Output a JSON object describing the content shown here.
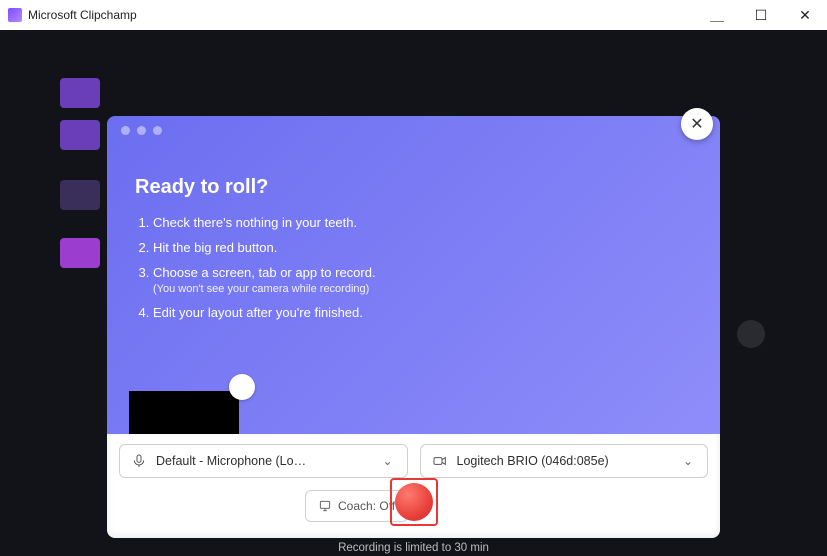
{
  "window": {
    "title": "Microsoft Clipchamp"
  },
  "modal": {
    "close_aria": "Close",
    "heading": "Ready to roll?",
    "steps": {
      "s1": "Check there's nothing in your teeth.",
      "s2": "Hit the big red button.",
      "s3": "Choose a screen, tab or app to record.",
      "s3_sub": "(You won't see your camera while recording)",
      "s4": "Edit your layout after you're finished."
    }
  },
  "controls": {
    "mic": {
      "label": "Default - Microphone (Lo…"
    },
    "camera": {
      "label": "Logitech BRIO (046d:085e)"
    },
    "coach": {
      "label": "Coach: Off"
    }
  },
  "footer": {
    "note": "Recording is limited to 30 min"
  }
}
